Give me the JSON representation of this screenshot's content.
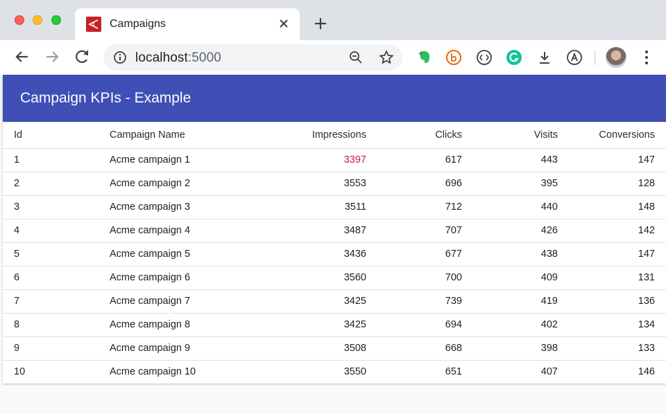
{
  "browser": {
    "tab": {
      "title": "Campaigns"
    },
    "url_host": "localhost",
    "url_port": ":5000"
  },
  "app": {
    "title": "Campaign KPIs - Example"
  },
  "table": {
    "columns": [
      "Id",
      "Campaign Name",
      "Impressions",
      "Clicks",
      "Visits",
      "Conversions"
    ],
    "rows": [
      [
        "1",
        "Acme campaign 1",
        "3397",
        "617",
        "443",
        "147"
      ],
      [
        "2",
        "Acme campaign 2",
        "3553",
        "696",
        "395",
        "128"
      ],
      [
        "3",
        "Acme campaign 3",
        "3511",
        "712",
        "440",
        "148"
      ],
      [
        "4",
        "Acme campaign 4",
        "3487",
        "707",
        "426",
        "142"
      ],
      [
        "5",
        "Acme campaign 5",
        "3436",
        "677",
        "438",
        "147"
      ],
      [
        "6",
        "Acme campaign 6",
        "3560",
        "700",
        "409",
        "131"
      ],
      [
        "7",
        "Acme campaign 7",
        "3425",
        "739",
        "419",
        "136"
      ],
      [
        "8",
        "Acme campaign 8",
        "3425",
        "694",
        "402",
        "134"
      ],
      [
        "9",
        "Acme campaign 9",
        "3508",
        "668",
        "398",
        "133"
      ],
      [
        "10",
        "Acme campaign 10",
        "3550",
        "651",
        "407",
        "146"
      ]
    ]
  },
  "icons": {
    "traffic_lights": [
      "close-window-icon",
      "minimize-window-icon",
      "maximize-window-icon"
    ],
    "toolbar": [
      "back-arrow-icon",
      "forward-arrow-icon",
      "reload-icon",
      "info-icon",
      "zoom-out-icon",
      "bookmark-star-icon"
    ],
    "extensions": [
      "evernote-icon",
      "b-extension-icon",
      "code-extension-icon",
      "grammarly-icon",
      "download-icon",
      "a-extension-icon"
    ]
  },
  "colors": {
    "app_bar": "#3f4fb5",
    "highlight_text": "#c2185b",
    "favicon": "#c8202a"
  }
}
